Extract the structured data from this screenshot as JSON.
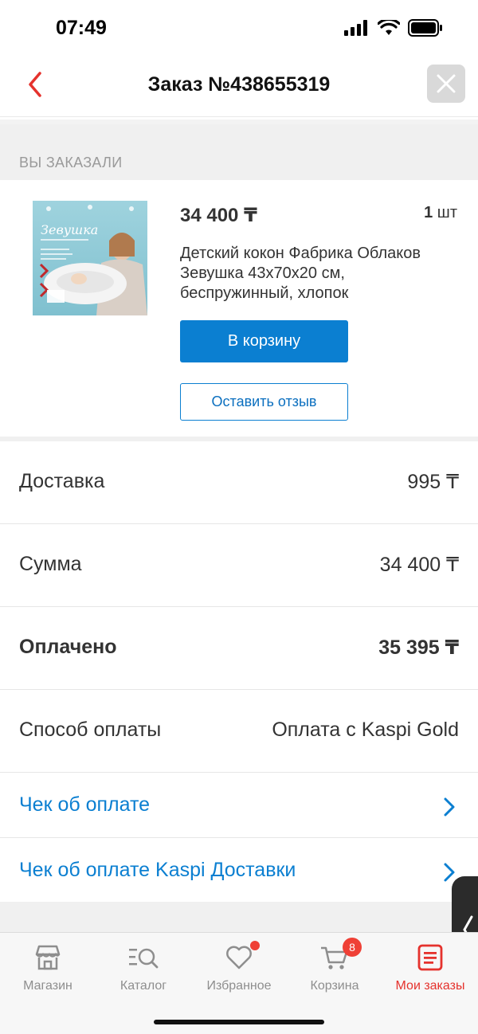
{
  "status_bar": {
    "time": "07:49"
  },
  "header": {
    "title": "Заказ №438655319"
  },
  "section": {
    "caption": "ВЫ ЗАКАЗАЛИ"
  },
  "product": {
    "price": "34 400 ₸",
    "qty_number": "1",
    "qty_unit": "шт",
    "name": "Детский кокон Фабрика Облаков Зевушка 43х70х20 см, беспружинный, хлопок",
    "image_title_text": "Зевушка",
    "cart_button": "В корзину",
    "review_button": "Оставить отзыв"
  },
  "summary": {
    "delivery_label": "Доставка",
    "delivery_value": "995 ₸",
    "sum_label": "Сумма",
    "sum_value": "34 400 ₸",
    "paid_label": "Оплачено",
    "paid_value": "35 395 ₸",
    "payment_label": "Способ оплаты",
    "payment_value": "Оплата с Kaspi Gold"
  },
  "links": {
    "receipt": "Чек об оплате",
    "delivery_receipt": "Чек об оплате Kaspi Доставки"
  },
  "tabbar": {
    "shop": "Магазин",
    "catalog": "Каталог",
    "favorites": "Избранное",
    "cart": "Корзина",
    "cart_badge": "8",
    "orders": "Мои заказы"
  },
  "colors": {
    "accent_blue": "#0b7fd1",
    "accent_red": "#e5322d"
  }
}
